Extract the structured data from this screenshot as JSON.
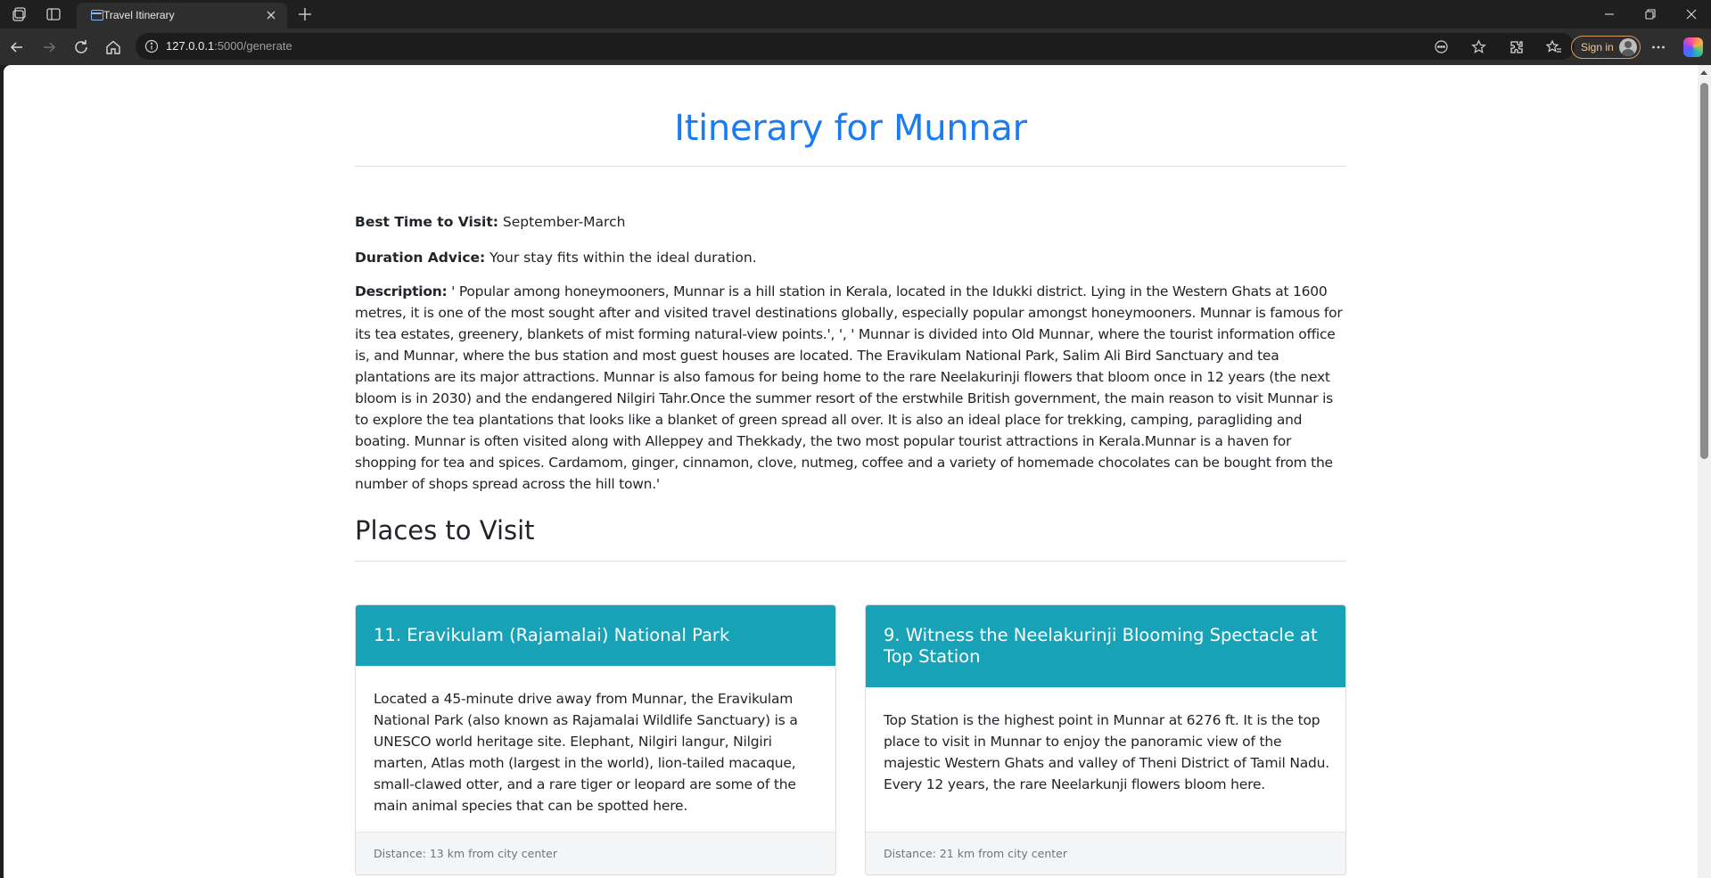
{
  "browser": {
    "tab_title": "Travel Itinerary",
    "url_host": "127.0.0.1",
    "url_rest": ":5000/generate",
    "signin_label": "Sign in"
  },
  "page": {
    "title": "Itinerary for Munnar",
    "best_time_label": "Best Time to Visit:",
    "best_time_value": "September-March",
    "duration_label": "Duration Advice:",
    "duration_value": "Your stay fits within the ideal duration.",
    "description_label": "Description:",
    "description_value": "' Popular among honeymooners, Munnar is a hill station in Kerala, located in the Idukki district. Lying in the Western Ghats at 1600 metres, it is one of the most sought after and visited travel destinations globally, especially popular amongst honeymooners. Munnar is famous for its tea estates, greenery, blankets of mist forming natural-view points.', ', ' Munnar is divided into Old Munnar, where the tourist information office is, and Munnar, where the bus station and most guest houses are located. The Eravikulam National Park, Salim Ali Bird Sanctuary and tea plantations are its major attractions. Munnar is also famous for being home to the rare Neelakurinji flowers that bloom once in 12 years (the next bloom is in 2030) and the endangered Nilgiri Tahr.Once the summer resort of the erstwhile British government, the main reason to visit Munnar is to explore the tea plantations that looks like a blanket of green spread all over. It is also an ideal place for trekking, camping, paragliding and boating. Munnar is often visited along with Alleppey and Thekkady, the two most popular tourist attractions in Kerala.Munnar is a haven for shopping for tea and spices. Cardamom, ginger, cinnamon, clove, nutmeg, coffee and a variety of homemade chocolates can be bought from the number of shops spread across the hill town.'",
    "places_heading": "Places to Visit",
    "places": [
      {
        "title": "11. Eravikulam (Rajamalai) National Park",
        "body": "Located a 45-minute drive away from Munnar, the Eravikulam National Park (also known as Rajamalai Wildlife Sanctuary) is a UNESCO world heritage site. Elephant, Nilgiri langur, Nilgiri marten, Atlas moth (largest in the world), lion-tailed macaque, small-clawed otter, and a rare tiger or leopard are some of the main animal species that can be spotted here.",
        "distance": "Distance: 13 km from city center"
      },
      {
        "title": "9. Witness the Neelakurinji Blooming Spectacle at Top Station",
        "body": "Top Station is the highest point in Munnar at 6276 ft. It is the top place to visit in Munnar to enjoy the panoramic view of the majestic Western Ghats and valley of Theni District of Tamil Nadu. Every 12 years, the rare Neelarkunji flowers bloom here.",
        "distance": "Distance: 21 km from city center"
      }
    ]
  },
  "colors": {
    "title_blue": "#1a7cf0",
    "card_header_teal": "#17a2b8"
  }
}
